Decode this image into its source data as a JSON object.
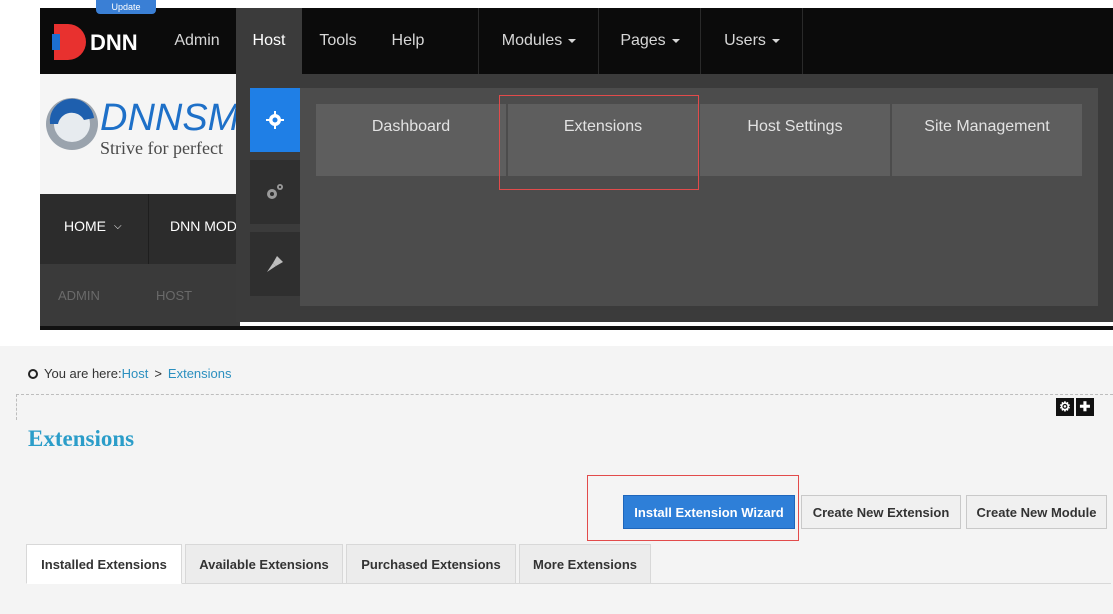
{
  "topbar": {
    "update_badge": "Update",
    "logo_text": "DNN",
    "items": [
      {
        "label": "Admin"
      },
      {
        "label": "Host"
      },
      {
        "label": "Tools"
      },
      {
        "label": "Help"
      },
      {
        "label": "Modules"
      },
      {
        "label": "Pages"
      },
      {
        "label": "Users"
      }
    ]
  },
  "site": {
    "logo_text": "DNNSM",
    "tagline": "Strive for perfect",
    "nav": [
      "HOME",
      "DNN MOD"
    ],
    "nav2": [
      "ADMIN",
      "HOST"
    ]
  },
  "megamenu": {
    "side_icons": [
      "gear-icon",
      "gears-icon",
      "pin-icon"
    ],
    "items": [
      {
        "label": "Dashboard"
      },
      {
        "label": "Extensions"
      },
      {
        "label": "Host Settings"
      },
      {
        "label": "Site Management"
      }
    ]
  },
  "breadcrumb": {
    "prefix": "You are here:",
    "host": "Host",
    "sep": ">",
    "current": "Extensions"
  },
  "page": {
    "title": "Extensions"
  },
  "buttons": {
    "install": "Install Extension Wizard",
    "create_ext": "Create New Extension",
    "create_mod": "Create New Module"
  },
  "tabs": [
    {
      "label": "Installed Extensions"
    },
    {
      "label": "Available Extensions"
    },
    {
      "label": "Purchased Extensions"
    },
    {
      "label": "More Extensions"
    }
  ],
  "colors": {
    "accent_blue": "#2e7fd8",
    "title_blue": "#2b9dc9",
    "highlight_red": "#e24b4b"
  }
}
